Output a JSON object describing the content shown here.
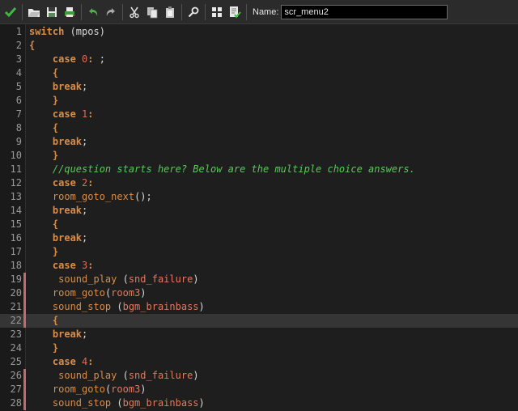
{
  "toolbar": {
    "name_label": "Name:",
    "name_value": "scr_menu2"
  },
  "icons": {
    "ok": "check-icon",
    "open": "open-folder-icon",
    "save": "save-icon",
    "print": "print-icon",
    "undo": "undo-icon",
    "redo": "redo-icon",
    "cut": "cut-icon",
    "copy": "copy-icon",
    "paste": "paste-icon",
    "find": "find-icon",
    "goto": "goto-line-icon",
    "check_script": "check-script-icon"
  },
  "colors": {
    "keyword": "#d88e4a",
    "number": "#e06a5a",
    "comment": "#5ac85a",
    "resource": "#e07a60",
    "text": "#d8d8d8",
    "background": "#1e1e1e",
    "current_line": "#353535",
    "change_marker": "#c06a6a"
  },
  "editor": {
    "current_line": 22,
    "lines": [
      {
        "n": "1",
        "marked": false,
        "tokens": [
          [
            "kw",
            "switch"
          ],
          [
            "plain",
            " (mpos)"
          ]
        ]
      },
      {
        "n": "2",
        "marked": false,
        "tokens": [
          [
            "kw",
            "{"
          ]
        ]
      },
      {
        "n": "3",
        "marked": false,
        "tokens": [
          [
            "plain",
            "    "
          ],
          [
            "kw",
            "case"
          ],
          [
            "plain",
            " "
          ],
          [
            "num",
            "0"
          ],
          [
            "kw",
            ":"
          ],
          [
            "plain",
            " ;"
          ]
        ]
      },
      {
        "n": "4",
        "marked": false,
        "tokens": [
          [
            "plain",
            "    "
          ],
          [
            "kw",
            "{"
          ]
        ]
      },
      {
        "n": "5",
        "marked": false,
        "tokens": [
          [
            "plain",
            "    "
          ],
          [
            "kw",
            "break"
          ],
          [
            "plain",
            ";"
          ]
        ]
      },
      {
        "n": "6",
        "marked": false,
        "tokens": [
          [
            "plain",
            "    "
          ],
          [
            "kw",
            "}"
          ]
        ]
      },
      {
        "n": "7",
        "marked": false,
        "tokens": [
          [
            "plain",
            "    "
          ],
          [
            "kw",
            "case"
          ],
          [
            "plain",
            " "
          ],
          [
            "num",
            "1"
          ],
          [
            "kw",
            ":"
          ]
        ]
      },
      {
        "n": "8",
        "marked": false,
        "tokens": [
          [
            "plain",
            "    "
          ],
          [
            "kw",
            "{"
          ]
        ]
      },
      {
        "n": "9",
        "marked": false,
        "tokens": [
          [
            "plain",
            "    "
          ],
          [
            "kw",
            "break"
          ],
          [
            "plain",
            ";"
          ]
        ]
      },
      {
        "n": "10",
        "marked": false,
        "tokens": [
          [
            "plain",
            "    "
          ],
          [
            "kw",
            "}"
          ]
        ]
      },
      {
        "n": "11",
        "marked": false,
        "tokens": [
          [
            "plain",
            "    "
          ],
          [
            "cmt",
            "//question starts here? Below are the multiple choice answers."
          ]
        ]
      },
      {
        "n": "12",
        "marked": false,
        "tokens": [
          [
            "plain",
            "    "
          ],
          [
            "kw",
            "case"
          ],
          [
            "plain",
            " "
          ],
          [
            "num",
            "2"
          ],
          [
            "kw",
            ":"
          ]
        ]
      },
      {
        "n": "13",
        "marked": false,
        "tokens": [
          [
            "plain",
            "    "
          ],
          [
            "fn",
            "room_goto_next"
          ],
          [
            "plain",
            "();"
          ]
        ]
      },
      {
        "n": "14",
        "marked": false,
        "tokens": [
          [
            "plain",
            "    "
          ],
          [
            "kw",
            "break"
          ],
          [
            "plain",
            ";"
          ]
        ]
      },
      {
        "n": "15",
        "marked": false,
        "tokens": [
          [
            "plain",
            "    "
          ],
          [
            "kw",
            "{"
          ]
        ]
      },
      {
        "n": "16",
        "marked": false,
        "tokens": [
          [
            "plain",
            "    "
          ],
          [
            "kw",
            "break"
          ],
          [
            "plain",
            ";"
          ]
        ]
      },
      {
        "n": "17",
        "marked": false,
        "tokens": [
          [
            "plain",
            "    "
          ],
          [
            "kw",
            "}"
          ]
        ]
      },
      {
        "n": "18",
        "marked": false,
        "tokens": [
          [
            "plain",
            "    "
          ],
          [
            "kw",
            "case"
          ],
          [
            "plain",
            " "
          ],
          [
            "num",
            "3"
          ],
          [
            "kw",
            ":"
          ]
        ]
      },
      {
        "n": "19",
        "marked": true,
        "tokens": [
          [
            "plain",
            "     "
          ],
          [
            "fn",
            "sound_play"
          ],
          [
            "plain",
            " ("
          ],
          [
            "res",
            "snd_failure"
          ],
          [
            "plain",
            ")"
          ]
        ]
      },
      {
        "n": "20",
        "marked": true,
        "tokens": [
          [
            "plain",
            "    "
          ],
          [
            "fn",
            "room_goto"
          ],
          [
            "plain",
            "("
          ],
          [
            "res",
            "room3"
          ],
          [
            "plain",
            ")"
          ]
        ]
      },
      {
        "n": "21",
        "marked": true,
        "tokens": [
          [
            "plain",
            "    "
          ],
          [
            "fn",
            "sound_stop"
          ],
          [
            "plain",
            " ("
          ],
          [
            "res",
            "bgm_brainbass"
          ],
          [
            "plain",
            ")"
          ]
        ]
      },
      {
        "n": "22",
        "marked": true,
        "tokens": [
          [
            "plain",
            "    "
          ],
          [
            "kw",
            "{"
          ]
        ]
      },
      {
        "n": "23",
        "marked": false,
        "tokens": [
          [
            "plain",
            "    "
          ],
          [
            "kw",
            "break"
          ],
          [
            "plain",
            ";"
          ]
        ]
      },
      {
        "n": "24",
        "marked": false,
        "tokens": [
          [
            "plain",
            "    "
          ],
          [
            "kw",
            "}"
          ]
        ]
      },
      {
        "n": "25",
        "marked": false,
        "tokens": [
          [
            "plain",
            "    "
          ],
          [
            "kw",
            "case"
          ],
          [
            "plain",
            " "
          ],
          [
            "num",
            "4"
          ],
          [
            "kw",
            ":"
          ]
        ]
      },
      {
        "n": "26",
        "marked": true,
        "tokens": [
          [
            "plain",
            "     "
          ],
          [
            "fn",
            "sound_play"
          ],
          [
            "plain",
            " ("
          ],
          [
            "res",
            "snd_failure"
          ],
          [
            "plain",
            ")"
          ]
        ]
      },
      {
        "n": "27",
        "marked": true,
        "tokens": [
          [
            "plain",
            "    "
          ],
          [
            "fn",
            "room_goto"
          ],
          [
            "plain",
            "("
          ],
          [
            "res",
            "room3"
          ],
          [
            "plain",
            ")"
          ]
        ]
      },
      {
        "n": "28",
        "marked": true,
        "tokens": [
          [
            "plain",
            "    "
          ],
          [
            "fn",
            "sound_stop"
          ],
          [
            "plain",
            " ("
          ],
          [
            "res",
            "bgm_brainbass"
          ],
          [
            "plain",
            ")"
          ]
        ]
      }
    ]
  }
}
